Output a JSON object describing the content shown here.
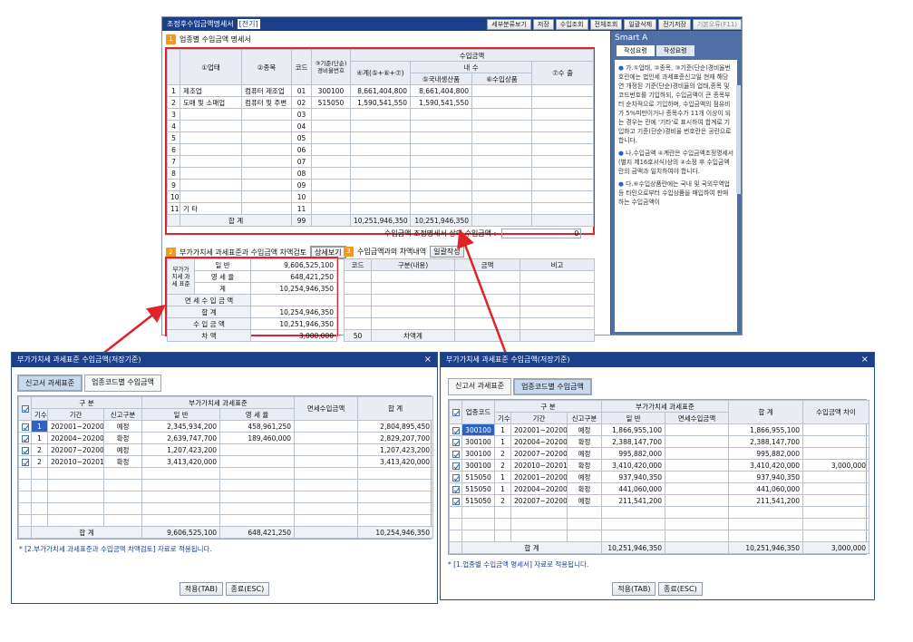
{
  "main": {
    "title": "조정후수입금액명세서",
    "title_tag": "[전기]",
    "toolbar": [
      "세부분류보기",
      "저장",
      "수입조회",
      "전체조회",
      "일괄삭제",
      "전기저장",
      "기본오류(F11)"
    ],
    "sec1": {
      "num": "1",
      "title": "업종별 수입금액 명세서",
      "headers": {
        "biz": "①업태",
        "item": "②종목",
        "code": "코드",
        "std": "③기준(단순)경비율번호",
        "income": "수입금액",
        "total": "④계(⑤+⑥+⑦)",
        "domestic_group": "내 수",
        "domestic": "⑤국내생산품",
        "import": "⑥수입상품",
        "export": "⑦수 출"
      },
      "rows": [
        {
          "no": "1",
          "biz": "제조업",
          "item": "컴퓨터 제조업",
          "code": "01",
          "std": "300100",
          "total": "8,661,404,800",
          "domestic": "8,661,404,800",
          "import": "",
          "export": ""
        },
        {
          "no": "2",
          "biz": "도매 및 소매업",
          "item": "컴퓨터 및 주변",
          "code": "02",
          "std": "515050",
          "total": "1,590,541,550",
          "domestic": "1,590,541,550",
          "import": "",
          "export": ""
        },
        {
          "no": "3",
          "biz": "",
          "item": "",
          "code": "03",
          "std": "",
          "total": "",
          "domestic": "",
          "import": "",
          "export": ""
        },
        {
          "no": "4",
          "biz": "",
          "item": "",
          "code": "04",
          "std": "",
          "total": "",
          "domestic": "",
          "import": "",
          "export": ""
        },
        {
          "no": "5",
          "biz": "",
          "item": "",
          "code": "05",
          "std": "",
          "total": "",
          "domestic": "",
          "import": "",
          "export": ""
        },
        {
          "no": "6",
          "biz": "",
          "item": "",
          "code": "06",
          "std": "",
          "total": "",
          "domestic": "",
          "import": "",
          "export": ""
        },
        {
          "no": "7",
          "biz": "",
          "item": "",
          "code": "07",
          "std": "",
          "total": "",
          "domestic": "",
          "import": "",
          "export": ""
        },
        {
          "no": "8",
          "biz": "",
          "item": "",
          "code": "08",
          "std": "",
          "total": "",
          "domestic": "",
          "import": "",
          "export": ""
        },
        {
          "no": "9",
          "biz": "",
          "item": "",
          "code": "09",
          "std": "",
          "total": "",
          "domestic": "",
          "import": "",
          "export": ""
        },
        {
          "no": "10",
          "biz": "",
          "item": "",
          "code": "10",
          "std": "",
          "total": "",
          "domestic": "",
          "import": "",
          "export": ""
        },
        {
          "no": "11",
          "biz": "기 타",
          "item": "",
          "code": "11",
          "std": "",
          "total": "",
          "domestic": "",
          "import": "",
          "export": ""
        }
      ],
      "sum": {
        "label": "합 계",
        "code": "99",
        "total": "10,251,946,350",
        "domestic": "10,251,946,350"
      },
      "adjust_label": "수입금액 조정명세서 상의 수입금액 :",
      "adjust_value": "0"
    },
    "sec2": {
      "num": "2",
      "title": "부가가치세 과세표준과 수입금액 차액검토",
      "detail_btn": "상세보기",
      "group_label": "부가가치세 과세 표준",
      "rows": [
        {
          "label": "일 반",
          "value": "9,606,525,100"
        },
        {
          "label": "영 세 율",
          "value": "648,421,250"
        },
        {
          "label": "계",
          "value": "10,254,946,350"
        },
        {
          "label": "면 세 수 입 금 액",
          "value": ""
        },
        {
          "label": "합 계",
          "value": "10,254,946,350"
        },
        {
          "label": "수 입 금 액",
          "value": "10,251,946,350"
        },
        {
          "label": "차 액",
          "value": "3,000,000"
        }
      ]
    },
    "sec3": {
      "num": "3",
      "title": "수입금액과의 차액내역",
      "btn": "일괄작성",
      "headers": [
        "코드",
        "구분(내용)",
        "금액",
        "비고"
      ],
      "sum_code": "50",
      "sum_label": "차액계"
    },
    "smart": {
      "title": "Smart A",
      "tabs": [
        "작성요령",
        "작성요령"
      ],
      "bullets": [
        "가.①업태, ②종목, ③기준(단순)경비율번호란에는 법인세 과세표준신고일 현재 해당연 개정된 기준(단순)경비율의 업태,종목 및 코드번호를 기입하되, 수입금액이 큰 종목부터 순차적으로 기입하며, 수입금액의 점유비가 5%미만이거나 종목수가 11개 이상이 되는 경우는 란에 '기타'로 표시하여 합계로 기입하고 기준(단순)경비율 번호란은 공란으로 합니다.",
        "나.수입금액 ④계란은 수입금액조정명세서(별지 제16호서식)상의 ④소정 후 수입금액란의 금액과 일치하여야 합니다.",
        "다.⑥수입상품란에는 국내 및 국외무역업 등 타인으로부터 수입상품을 매입하여 판매하는 수입금액이"
      ]
    }
  },
  "dlg1": {
    "title": "부가가치세 과세표준 수입금액(저장기준)",
    "close": "×",
    "tabs": [
      "신고서 과세표준",
      "업종코드별 수입금액"
    ],
    "headers": {
      "div": "구 분",
      "vat": "부가가치세 과세표준",
      "exempt": "면세수입금액",
      "total": "합 계",
      "seq": "기수",
      "period": "기간",
      "type": "신고구분",
      "general": "일 반",
      "zero": "영 세 율"
    },
    "rows": [
      {
        "seq": "1",
        "period": "202001~202003",
        "type": "예정",
        "general": "2,345,934,200",
        "zero": "458,961,250",
        "exempt": "",
        "total": "2,804,895,450"
      },
      {
        "seq": "1",
        "period": "202004~202006",
        "type": "확정",
        "general": "2,639,747,700",
        "zero": "189,460,000",
        "exempt": "",
        "total": "2,829,207,700"
      },
      {
        "seq": "2",
        "period": "202007~202009",
        "type": "예정",
        "general": "1,207,423,200",
        "zero": "",
        "exempt": "",
        "total": "1,207,423,200"
      },
      {
        "seq": "2",
        "period": "202010~202012",
        "type": "확정",
        "general": "3,413,420,000",
        "zero": "",
        "exempt": "",
        "total": "3,413,420,000"
      }
    ],
    "sum": {
      "label": "합 계",
      "general": "9,606,525,100",
      "zero": "648,421,250",
      "total": "10,254,946,350"
    },
    "note": "* [2.부가가치세 과세표준과 수입금액 차액검토] 자료로 적용됩니다.",
    "apply": "적용(TAB)",
    "close_btn": "종료(ESC)"
  },
  "dlg2": {
    "title": "부가가치세 과세표준 수입금액(저장기준)",
    "close": "×",
    "tabs": [
      "신고서 과세표준",
      "업종코드별 수입금액"
    ],
    "headers": {
      "code": "업종코드",
      "div": "구 분",
      "vat": "부가가치세 과세표준",
      "total": "합 계",
      "diff": "수입금액 차이",
      "seq": "기수",
      "period": "기간",
      "type": "신고구분",
      "general": "일 반",
      "exempt": "면세수입금액"
    },
    "rows": [
      {
        "code": "300100",
        "seq": "1",
        "period": "202001~202003",
        "type": "예정",
        "general": "1,866,955,100",
        "exempt": "",
        "total": "1,866,955,100",
        "diff": ""
      },
      {
        "code": "300100",
        "seq": "1",
        "period": "202004~202006",
        "type": "확정",
        "general": "2,388,147,700",
        "exempt": "",
        "total": "2,388,147,700",
        "diff": ""
      },
      {
        "code": "300100",
        "seq": "2",
        "period": "202007~202009",
        "type": "예정",
        "general": "995,882,000",
        "exempt": "",
        "total": "995,882,000",
        "diff": ""
      },
      {
        "code": "300100",
        "seq": "2",
        "period": "202010~202012",
        "type": "확정",
        "general": "3,410,420,000",
        "exempt": "",
        "total": "3,410,420,000",
        "diff": "3,000,000"
      },
      {
        "code": "515050",
        "seq": "1",
        "period": "202001~202003",
        "type": "예정",
        "general": "937,940,350",
        "exempt": "",
        "total": "937,940,350",
        "diff": ""
      },
      {
        "code": "515050",
        "seq": "1",
        "period": "202004~202006",
        "type": "확정",
        "general": "441,060,000",
        "exempt": "",
        "total": "441,060,000",
        "diff": ""
      },
      {
        "code": "515050",
        "seq": "2",
        "period": "202007~202009",
        "type": "예정",
        "general": "211,541,200",
        "exempt": "",
        "total": "211,541,200",
        "diff": ""
      }
    ],
    "sum": {
      "label": "합 계",
      "general": "10,251,946,350",
      "total": "10,251,946,350",
      "diff": "3,000,000"
    },
    "note": "* [1.업종별 수입금액 명세서] 자료로 적용됩니다.",
    "apply": "적용(TAB)",
    "close_btn": "종료(ESC)"
  },
  "colors": {
    "accent_red": "#e0222a",
    "title_blue": "#1b3f8b",
    "selected": "#2d62c2"
  }
}
